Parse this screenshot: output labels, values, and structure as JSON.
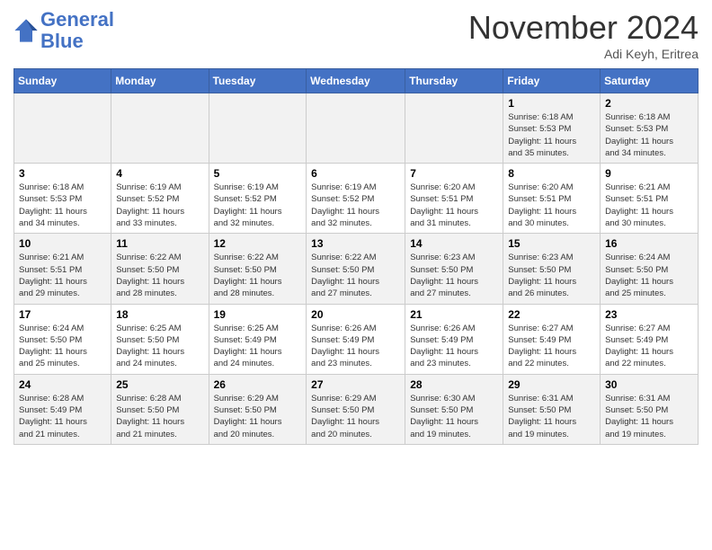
{
  "header": {
    "logo_line1": "General",
    "logo_line2": "Blue",
    "month": "November 2024",
    "location": "Adi Keyh, Eritrea"
  },
  "weekdays": [
    "Sunday",
    "Monday",
    "Tuesday",
    "Wednesday",
    "Thursday",
    "Friday",
    "Saturday"
  ],
  "weeks": [
    [
      {
        "day": "",
        "info": ""
      },
      {
        "day": "",
        "info": ""
      },
      {
        "day": "",
        "info": ""
      },
      {
        "day": "",
        "info": ""
      },
      {
        "day": "",
        "info": ""
      },
      {
        "day": "1",
        "info": "Sunrise: 6:18 AM\nSunset: 5:53 PM\nDaylight: 11 hours\nand 35 minutes."
      },
      {
        "day": "2",
        "info": "Sunrise: 6:18 AM\nSunset: 5:53 PM\nDaylight: 11 hours\nand 34 minutes."
      }
    ],
    [
      {
        "day": "3",
        "info": "Sunrise: 6:18 AM\nSunset: 5:53 PM\nDaylight: 11 hours\nand 34 minutes."
      },
      {
        "day": "4",
        "info": "Sunrise: 6:19 AM\nSunset: 5:52 PM\nDaylight: 11 hours\nand 33 minutes."
      },
      {
        "day": "5",
        "info": "Sunrise: 6:19 AM\nSunset: 5:52 PM\nDaylight: 11 hours\nand 32 minutes."
      },
      {
        "day": "6",
        "info": "Sunrise: 6:19 AM\nSunset: 5:52 PM\nDaylight: 11 hours\nand 32 minutes."
      },
      {
        "day": "7",
        "info": "Sunrise: 6:20 AM\nSunset: 5:51 PM\nDaylight: 11 hours\nand 31 minutes."
      },
      {
        "day": "8",
        "info": "Sunrise: 6:20 AM\nSunset: 5:51 PM\nDaylight: 11 hours\nand 30 minutes."
      },
      {
        "day": "9",
        "info": "Sunrise: 6:21 AM\nSunset: 5:51 PM\nDaylight: 11 hours\nand 30 minutes."
      }
    ],
    [
      {
        "day": "10",
        "info": "Sunrise: 6:21 AM\nSunset: 5:51 PM\nDaylight: 11 hours\nand 29 minutes."
      },
      {
        "day": "11",
        "info": "Sunrise: 6:22 AM\nSunset: 5:50 PM\nDaylight: 11 hours\nand 28 minutes."
      },
      {
        "day": "12",
        "info": "Sunrise: 6:22 AM\nSunset: 5:50 PM\nDaylight: 11 hours\nand 28 minutes."
      },
      {
        "day": "13",
        "info": "Sunrise: 6:22 AM\nSunset: 5:50 PM\nDaylight: 11 hours\nand 27 minutes."
      },
      {
        "day": "14",
        "info": "Sunrise: 6:23 AM\nSunset: 5:50 PM\nDaylight: 11 hours\nand 27 minutes."
      },
      {
        "day": "15",
        "info": "Sunrise: 6:23 AM\nSunset: 5:50 PM\nDaylight: 11 hours\nand 26 minutes."
      },
      {
        "day": "16",
        "info": "Sunrise: 6:24 AM\nSunset: 5:50 PM\nDaylight: 11 hours\nand 25 minutes."
      }
    ],
    [
      {
        "day": "17",
        "info": "Sunrise: 6:24 AM\nSunset: 5:50 PM\nDaylight: 11 hours\nand 25 minutes."
      },
      {
        "day": "18",
        "info": "Sunrise: 6:25 AM\nSunset: 5:50 PM\nDaylight: 11 hours\nand 24 minutes."
      },
      {
        "day": "19",
        "info": "Sunrise: 6:25 AM\nSunset: 5:49 PM\nDaylight: 11 hours\nand 24 minutes."
      },
      {
        "day": "20",
        "info": "Sunrise: 6:26 AM\nSunset: 5:49 PM\nDaylight: 11 hours\nand 23 minutes."
      },
      {
        "day": "21",
        "info": "Sunrise: 6:26 AM\nSunset: 5:49 PM\nDaylight: 11 hours\nand 23 minutes."
      },
      {
        "day": "22",
        "info": "Sunrise: 6:27 AM\nSunset: 5:49 PM\nDaylight: 11 hours\nand 22 minutes."
      },
      {
        "day": "23",
        "info": "Sunrise: 6:27 AM\nSunset: 5:49 PM\nDaylight: 11 hours\nand 22 minutes."
      }
    ],
    [
      {
        "day": "24",
        "info": "Sunrise: 6:28 AM\nSunset: 5:49 PM\nDaylight: 11 hours\nand 21 minutes."
      },
      {
        "day": "25",
        "info": "Sunrise: 6:28 AM\nSunset: 5:50 PM\nDaylight: 11 hours\nand 21 minutes."
      },
      {
        "day": "26",
        "info": "Sunrise: 6:29 AM\nSunset: 5:50 PM\nDaylight: 11 hours\nand 20 minutes."
      },
      {
        "day": "27",
        "info": "Sunrise: 6:29 AM\nSunset: 5:50 PM\nDaylight: 11 hours\nand 20 minutes."
      },
      {
        "day": "28",
        "info": "Sunrise: 6:30 AM\nSunset: 5:50 PM\nDaylight: 11 hours\nand 19 minutes."
      },
      {
        "day": "29",
        "info": "Sunrise: 6:31 AM\nSunset: 5:50 PM\nDaylight: 11 hours\nand 19 minutes."
      },
      {
        "day": "30",
        "info": "Sunrise: 6:31 AM\nSunset: 5:50 PM\nDaylight: 11 hours\nand 19 minutes."
      }
    ]
  ]
}
